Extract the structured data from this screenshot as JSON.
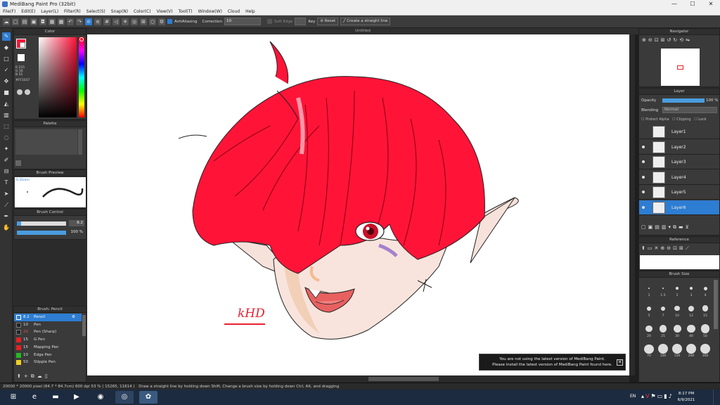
{
  "window": {
    "title": "MediBang Paint Pro (32bit)",
    "min": "—",
    "max": "☐",
    "close": "✕"
  },
  "menu": [
    "File(F)",
    "Edit(E)",
    "Layer(L)",
    "Filter(R)",
    "Select(S)",
    "Snap(N)",
    "Color(C)",
    "View(V)",
    "Tool(T)",
    "Window(W)",
    "Cloud",
    "Help"
  ],
  "toolbar": {
    "antialias_label": "AntiAliasing",
    "correction_label": "Correction",
    "correction_value": "10",
    "soft_edge_label": "Soft Edge",
    "key_label": "Key",
    "reset_label": "Reset",
    "straight_line_label": "Create a straight line"
  },
  "color_panel": {
    "title": "Color",
    "r": "R 255",
    "g": "G 16",
    "b": "B 55",
    "hex": "#FF1037",
    "fg_color": "#ff1037",
    "bg_color": "#ffffff"
  },
  "palette": {
    "title": "Palette"
  },
  "brush_preview": {
    "title": "Brush Preview",
    "size": "0.35mm"
  },
  "brush_control": {
    "title": "Brush Control",
    "size_value": "8.2",
    "opacity_value": "100 %",
    "size_fraction": 0.08,
    "opacity_fraction": 1.0
  },
  "brush_list": {
    "title": "Brush: Pencil",
    "items": [
      {
        "size": "8.2",
        "name": "Pencil",
        "color": "#2d7dd2"
      },
      {
        "size": "10",
        "name": "Pen",
        "color": "#222222"
      },
      {
        "size": "20",
        "name": "Pen (Sharp)",
        "color": "#222222"
      },
      {
        "size": "15",
        "name": "G Pen",
        "color": "#e82020"
      },
      {
        "size": "15",
        "name": "Mapping Pen",
        "color": "#e82020"
      },
      {
        "size": "10",
        "name": "Edge Pen",
        "color": "#22bb22"
      },
      {
        "size": "50",
        "name": "Stipple Pen",
        "color": "#f0d020"
      }
    ]
  },
  "canvas": {
    "doc_title": "Untitled",
    "signature": "kHD"
  },
  "notice": {
    "line1": "You are not using the latest version of MediBang Paint.",
    "line2": "Please install the latest version of MediBang Paint found here.",
    "close": "✕"
  },
  "navigator": {
    "title": "Navigator"
  },
  "layer_panel": {
    "title": "Layer",
    "opacity_label": "Opacity",
    "opacity_value": "100 %",
    "blending_label": "Blending",
    "blending_value": "Normal",
    "protect_alpha": "Protect Alpha",
    "clipping": "Clipping",
    "lock": "Lock",
    "layers": [
      {
        "name": "Layer1",
        "visible": false,
        "selected": false
      },
      {
        "name": "Layer2",
        "visible": true,
        "selected": false
      },
      {
        "name": "Layer3",
        "visible": true,
        "selected": false
      },
      {
        "name": "Layer4",
        "visible": true,
        "selected": false
      },
      {
        "name": "Layer5",
        "visible": true,
        "selected": false
      },
      {
        "name": "Layer6",
        "visible": true,
        "selected": true
      }
    ]
  },
  "reference": {
    "title": "Reference"
  },
  "brush_size": {
    "title": "Brush Size",
    "values": [
      "1",
      "1.5",
      "2",
      "3",
      "4",
      "5",
      "7",
      "10",
      "12",
      "15",
      "20",
      "25",
      "30",
      "40",
      "50",
      "70",
      "100",
      "150",
      "200",
      "300"
    ]
  },
  "status": {
    "canvas_size": "20000 * 20000 pixel",
    "physical_size": "(84.7 * 84.7cm)",
    "dpi": "600 dpi",
    "zoom": "53 %",
    "coords": "( 15265, 11614 )",
    "hint": "Draw a straight line by holding down Shift, Change a brush size by holding down Ctrl, Alt, and dragging"
  },
  "taskbar": {
    "lang": "EN",
    "time": "8:17 PM",
    "date": "6/9/2021"
  }
}
